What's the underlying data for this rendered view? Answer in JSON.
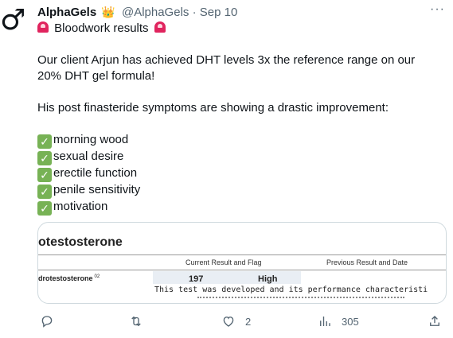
{
  "tweet": {
    "avatar_symbol": "♂",
    "display_name": "AlphaGels",
    "badge_emoji": "👑",
    "handle": "@AlphaGels",
    "separator": "·",
    "date": "Sep 10",
    "more_icon": "···",
    "headline": "Bloodwork results",
    "paragraph1_line1": "Our client Arjun has achieved DHT levels 3x the reference range on our",
    "paragraph1_line2": "20% DHT gel formula!",
    "paragraph2": "His post finasteride symptoms are showing a drastic improvement:",
    "checklist": [
      "morning wood",
      "sexual desire",
      "erectile function",
      "penile sensitivity",
      "motivation"
    ],
    "check_glyph": "✓"
  },
  "media": {
    "title": "otestosterone",
    "col_current": "Current Result and Flag",
    "col_previous": "Previous Result and Date",
    "test_name": "drotestosterone",
    "test_sup": "02",
    "value": "197",
    "flag": "High",
    "note": "This test was developed and its performance characteristi"
  },
  "actions": {
    "reply_icon": "reply-icon",
    "retweet_icon": "retweet-icon",
    "like_icon": "heart-icon",
    "like_count": "2",
    "views_icon": "views-icon",
    "views_count": "305",
    "share_icon": "share-icon"
  }
}
